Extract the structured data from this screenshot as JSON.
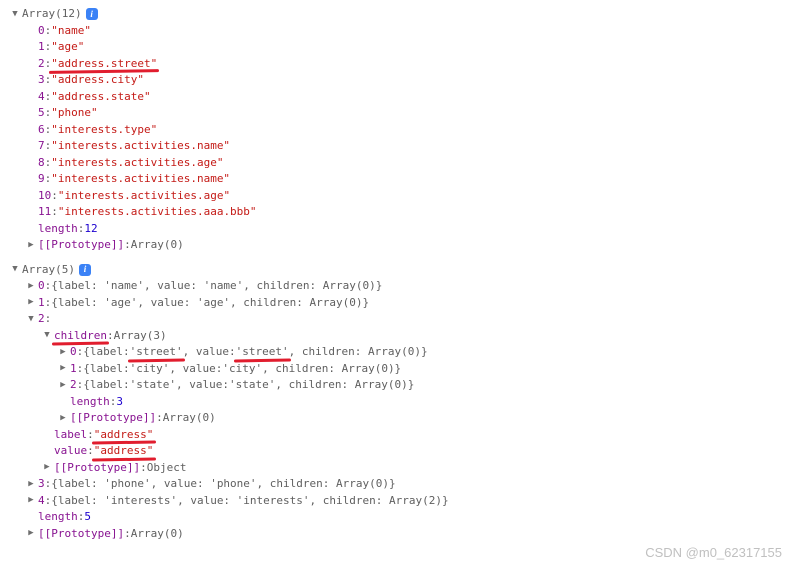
{
  "arr1": {
    "header": "Array(12)",
    "items": [
      {
        "idx": "0",
        "val": "\"name\""
      },
      {
        "idx": "1",
        "val": "\"age\""
      },
      {
        "idx": "2",
        "val": "\"address.street\"",
        "mark": true
      },
      {
        "idx": "3",
        "val": "\"address.city\""
      },
      {
        "idx": "4",
        "val": "\"address.state\""
      },
      {
        "idx": "5",
        "val": "\"phone\""
      },
      {
        "idx": "6",
        "val": "\"interests.type\""
      },
      {
        "idx": "7",
        "val": "\"interests.activities.name\""
      },
      {
        "idx": "8",
        "val": "\"interests.activities.age\""
      },
      {
        "idx": "9",
        "val": "\"interests.activities.name\""
      },
      {
        "idx": "10",
        "val": "\"interests.activities.age\""
      },
      {
        "idx": "11",
        "val": "\"interests.activities.aaa.bbb\""
      }
    ],
    "lengthLabel": "length",
    "lengthVal": "12",
    "protoLabel": "[[Prototype]]",
    "protoVal": "Array(0)"
  },
  "arr2": {
    "header": "Array(5)",
    "row0": {
      "idx": "0",
      "summary": "{label: 'name', value: 'name', children: Array(0)}"
    },
    "row1": {
      "idx": "1",
      "summary": "{label: 'age', value: 'age', children: Array(0)}"
    },
    "row2": {
      "idx": "2",
      "childrenLabel": "children",
      "childrenVal": "Array(3)",
      "childItems": [
        {
          "idx": "0",
          "summary": "children: Array(0)}",
          "label": "'street'",
          "value": "'street'",
          "mark": true
        },
        {
          "idx": "1",
          "summary": "children: Array(0)}",
          "label": "'city'",
          "value": "'city'"
        },
        {
          "idx": "2",
          "summary": "children: Array(0)}",
          "label": "'state'",
          "value": "'state'"
        }
      ],
      "childLengthLabel": "length",
      "childLengthVal": "3",
      "childProtoLabel": "[[Prototype]]",
      "childProtoVal": "Array(0)",
      "labelKey": "label",
      "labelVal": "\"address\"",
      "valueKey": "value",
      "valueVal": "\"address\"",
      "protoLabel": "[[Prototype]]",
      "protoVal": "Object"
    },
    "row3": {
      "idx": "3",
      "summary": "{label: 'phone', value: 'phone', children: Array(0)}"
    },
    "row4": {
      "idx": "4",
      "summary": "{label: 'interests', value: 'interests', children: Array(2)}"
    },
    "lengthLabel": "length",
    "lengthVal": "5",
    "protoLabel": "[[Prototype]]",
    "protoVal": "Array(0)"
  },
  "labels": {
    "labelWord": "label: ",
    "valueWord": ", value: ",
    "openBrace": "{",
    "commaSpace": ", "
  },
  "watermark": "CSDN @m0_62317155"
}
